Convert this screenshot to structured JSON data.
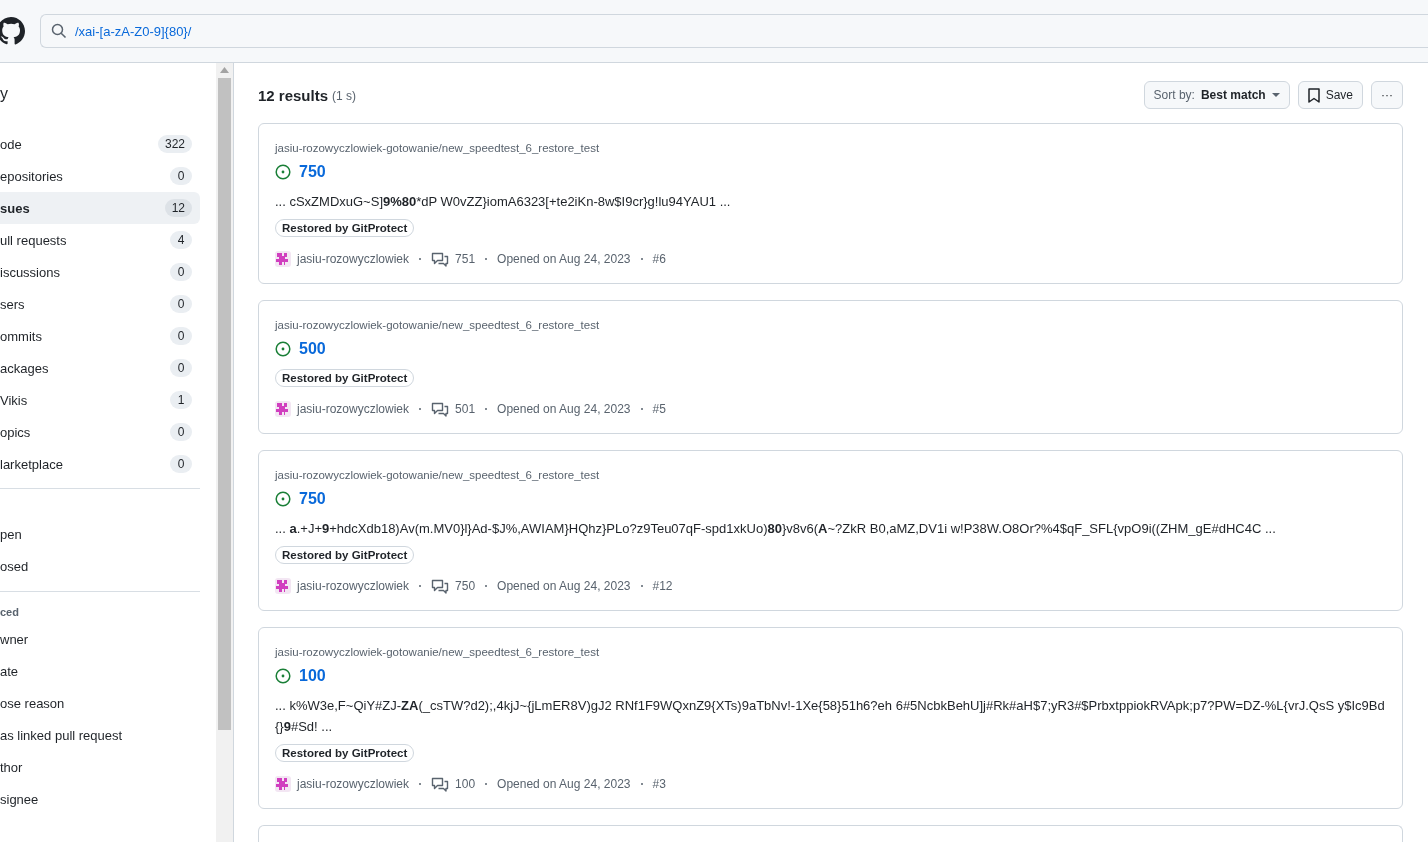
{
  "header": {
    "search": {
      "value": "/xai-[a-zA-Z0-9]{80}/"
    }
  },
  "sidebar": {
    "title": "y",
    "types": [
      {
        "label": "ode",
        "count": "322",
        "selected": false
      },
      {
        "label": "epositories",
        "count": "0",
        "selected": false
      },
      {
        "label": "sues",
        "count": "12",
        "selected": true
      },
      {
        "label": "ull requests",
        "count": "4",
        "selected": false
      },
      {
        "label": "iscussions",
        "count": "0",
        "selected": false
      },
      {
        "label": "sers",
        "count": "0",
        "selected": false
      },
      {
        "label": "ommits",
        "count": "0",
        "selected": false
      },
      {
        "label": "ackages",
        "count": "0",
        "selected": false
      },
      {
        "label": "Vikis",
        "count": "1",
        "selected": false
      },
      {
        "label": "opics",
        "count": "0",
        "selected": false
      },
      {
        "label": "larketplace",
        "count": "0",
        "selected": false
      }
    ],
    "state": [
      "pen",
      "osed"
    ],
    "advanced_heading": "ced",
    "advanced": [
      "wner",
      "ate",
      "ose reason",
      "as linked pull request",
      "thor",
      "signee"
    ]
  },
  "results": {
    "count": "12 results",
    "time": "(1 s)",
    "sort": {
      "label": "Sort by:",
      "value": "Best match"
    },
    "save": "Save",
    "more": "···",
    "items": [
      {
        "repo": "jasiu-rozowyczlowiek-gotowanie/new_speedtest_6_restore_test",
        "title": "750",
        "snippet": [
          {
            "text": "... cSxZMDxuG~S]",
            "bold": false
          },
          {
            "text": "9%80",
            "bold": true
          },
          {
            "text": "*dP W0vZZ}iomA6323[+te2iKn-8w$I9cr}g!lu94YAU1 ...",
            "bold": false
          }
        ],
        "label": "Restored by GitProtect",
        "author": "jasiu-rozowyczlowiek",
        "comments": "751",
        "opened": "Opened on Aug 24, 2023",
        "number": "#6"
      },
      {
        "repo": "jasiu-rozowyczlowiek-gotowanie/new_speedtest_6_restore_test",
        "title": "500",
        "label": "Restored by GitProtect",
        "author": "jasiu-rozowyczlowiek",
        "comments": "501",
        "opened": "Opened on Aug 24, 2023",
        "number": "#5"
      },
      {
        "repo": "jasiu-rozowyczlowiek-gotowanie/new_speedtest_6_restore_test",
        "title": "750",
        "snippet": [
          {
            "text": "... ",
            "bold": false
          },
          {
            "text": "a",
            "bold": true
          },
          {
            "text": ".+J+",
            "bold": false
          },
          {
            "text": "9",
            "bold": true
          },
          {
            "text": "+hdcXdb18)Av(m.MV0}l}Ad-$J%,AWIAM}HQhz}PLo?z9Teu07qF-spd1xkUo)",
            "bold": false
          },
          {
            "text": "80",
            "bold": true
          },
          {
            "text": "}v8v6(",
            "bold": false
          },
          {
            "text": "A",
            "bold": true
          },
          {
            "text": "~?ZkR B0,aMZ,DV1i w!P38W.O8Or?%4$qF_SFL{vpO9i((ZHM_gE#dHC4C ...",
            "bold": false
          }
        ],
        "label": "Restored by GitProtect",
        "author": "jasiu-rozowyczlowiek",
        "comments": "750",
        "opened": "Opened on Aug 24, 2023",
        "number": "#12"
      },
      {
        "repo": "jasiu-rozowyczlowiek-gotowanie/new_speedtest_6_restore_test",
        "title": "100",
        "snippet": [
          {
            "text": "... k%W3e,F~QiY#ZJ-",
            "bold": false
          },
          {
            "text": "ZA",
            "bold": true
          },
          {
            "text": "(_csTW?d2);,4kjJ~{jLmER8V)gJ2 RNf1F9WQxnZ9{XTs)9aTbNv!-1Xe{58}51h6?eh 6#5NcbkBehU]j#Rk#aH$7;yR3#$PrbxtppiokRVApk;p7?PW=DZ-%L{vrJ.QsS y$Ic9Bd{}",
            "bold": false
          },
          {
            "text": "9",
            "bold": true
          },
          {
            "text": "#Sd! ...",
            "bold": false
          }
        ],
        "label": "Restored by GitProtect",
        "author": "jasiu-rozowyczlowiek",
        "comments": "100",
        "opened": "Opened on Aug 24, 2023",
        "number": "#3"
      }
    ]
  }
}
